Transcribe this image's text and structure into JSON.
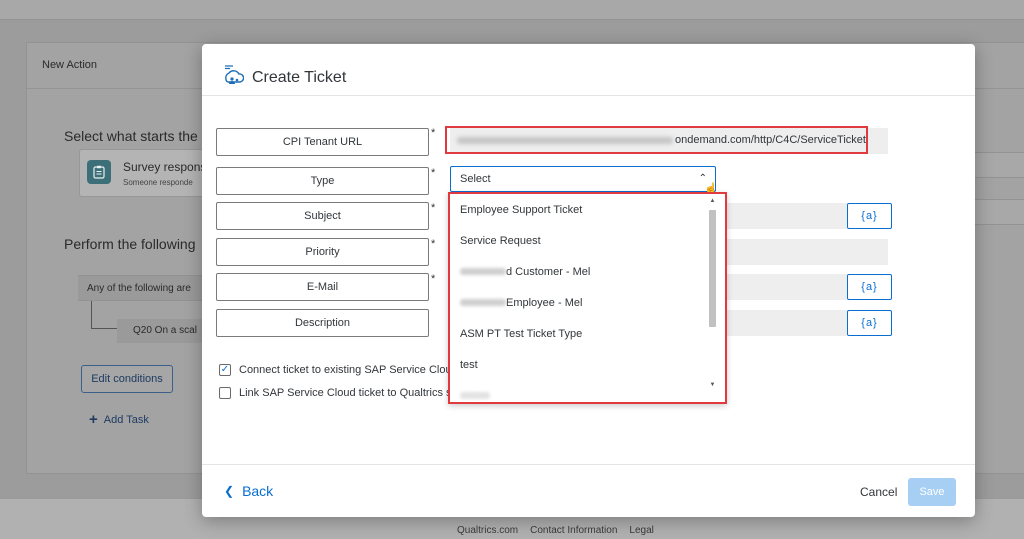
{
  "background": {
    "panel_title": "New Action",
    "start_heading": "Select what starts the a",
    "trigger_card": {
      "title": "Survey respons",
      "subtitle": "Someone responde"
    },
    "perform_heading": "Perform the following",
    "condition_text": "Any of the following are",
    "question_text": "Q20 On a scal",
    "edit_conditions_label": "Edit conditions",
    "add_task_label": "Add Task",
    "footer_links": [
      "Qualtrics.com",
      "Contact Information",
      "Legal"
    ]
  },
  "dialog": {
    "title": "Create Ticket",
    "fields": [
      {
        "label": "CPI Tenant URL",
        "required": "*"
      },
      {
        "label": "Type",
        "required": "*"
      },
      {
        "label": "Subject",
        "required": "*"
      },
      {
        "label": "Priority",
        "required": "*"
      },
      {
        "label": "E-Mail",
        "required": "*"
      },
      {
        "label": "Description",
        "required": ""
      }
    ],
    "url_value_suffix": "ondemand.com/http/C4C/ServiceTicket",
    "type_select_value": "Select",
    "variable_button_label": "{a}",
    "checkboxes": [
      {
        "label": "Connect ticket to existing SAP Service Cloud",
        "checked": true
      },
      {
        "label": "Link SAP Service Cloud ticket to Qualtrics su",
        "checked": false
      }
    ],
    "back_label": "Back",
    "cancel_label": "Cancel",
    "save_label": "Save"
  },
  "dropdown": {
    "options": [
      "Employee Support Ticket",
      "Service Request",
      "d Customer - Mel",
      " Employee - Mel",
      "ASM PT Test Ticket Type",
      "test"
    ]
  },
  "colors": {
    "accent": "#0a6ed1",
    "highlight": "#e03a3e",
    "save_disabled": "#a6cff3"
  }
}
